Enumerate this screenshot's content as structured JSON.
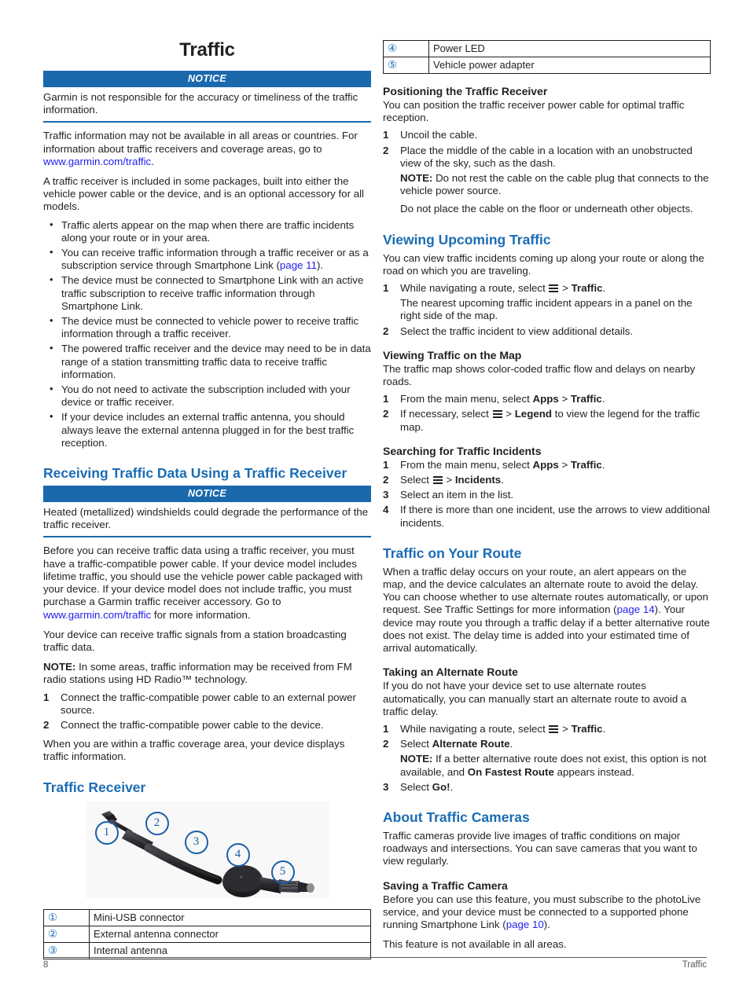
{
  "document": {
    "title": "Traffic",
    "footer_page": "8",
    "footer_section": "Traffic"
  },
  "colors": {
    "heading_blue": "#1a6cb4",
    "notice_bar_blue": "#1a69ad",
    "link_blue": "#2222ee",
    "callout_blue": "#1a5fa8",
    "text": "#231f20"
  },
  "left_column": {
    "notice1": {
      "label": "NOTICE",
      "text": "Garmin is not responsible for the accuracy or timeliness of the traffic information."
    },
    "para1_a": "Traffic information may not be available in all areas or countries. For information about traffic receivers and coverage areas, go to ",
    "para1_link": "www.garmin.com/traffic",
    "para1_b": ".",
    "para2": "A traffic receiver is included in some packages, built into either the vehicle power cable or the device, and is an optional accessory for all models.",
    "bullets": [
      {
        "text_a": "Traffic alerts appear on the map when there are traffic incidents along your route or in your area.",
        "link": "",
        "text_b": ""
      },
      {
        "text_a": "You can receive traffic information through a traffic receiver or as a subscription service through Smartphone Link (",
        "link": "page 11",
        "text_b": ")."
      },
      {
        "text_a": "The device must be connected to Smartphone Link with an active traffic subscription to receive traffic information through Smartphone Link.",
        "link": "",
        "text_b": ""
      },
      {
        "text_a": "The device must be connected to vehicle power to receive traffic information through a traffic receiver.",
        "link": "",
        "text_b": ""
      },
      {
        "text_a": "The powered traffic receiver and the device may need to be in data range of a station transmitting traffic data to receive traffic information.",
        "link": "",
        "text_b": ""
      },
      {
        "text_a": "You do not need to activate the subscription included with your device or traffic receiver.",
        "link": "",
        "text_b": ""
      },
      {
        "text_a": "If your device includes an external traffic antenna, you should always leave the external antenna plugged in for the best traffic reception.",
        "link": "",
        "text_b": ""
      }
    ],
    "heading_receiving": "Receiving Traffic Data Using a Traffic Receiver",
    "notice2": {
      "label": "NOTICE",
      "text": "Heated (metallized) windshields could degrade the performance of the traffic receiver."
    },
    "para3_a": "Before you can receive traffic data using a traffic receiver, you must have a traffic-compatible power cable. If your device model includes lifetime traffic, you should use the vehicle power cable packaged with your device. If your device model does not include traffic, you must purchase a Garmin traffic receiver accessory. Go to ",
    "para3_link": "www.garmin.com/traffic",
    "para3_b": " for more information.",
    "para4": "Your device can receive traffic signals from a station broadcasting traffic data.",
    "note1_label": "NOTE:",
    "note1_text": " In some areas, traffic information may be received from FM radio stations using HD Radio™ technology.",
    "steps_receiving": [
      {
        "num": "1",
        "text": "Connect the traffic-compatible power cable to an external power source."
      },
      {
        "num": "2",
        "text": "Connect the traffic-compatible power cable to the device."
      }
    ],
    "para5": "When you are within a traffic coverage area, your device displays traffic information.",
    "heading_receiver": "Traffic Receiver",
    "figure": {
      "name": "traffic-receiver-cable-diagram",
      "callouts": [
        "1",
        "2",
        "3",
        "4",
        "5"
      ]
    },
    "table_rows": [
      {
        "marker": "①",
        "label": "Mini-USB connector"
      },
      {
        "marker": "②",
        "label": "External antenna connector"
      },
      {
        "marker": "③",
        "label": "Internal antenna"
      }
    ]
  },
  "right_column": {
    "table_rows": [
      {
        "marker": "④",
        "label": "Power LED"
      },
      {
        "marker": "⑤",
        "label": "Vehicle power adapter"
      }
    ],
    "heading_positioning": "Positioning the Traffic Receiver",
    "para_positioning": "You can position the traffic receiver power cable for optimal traffic reception.",
    "steps_positioning": [
      {
        "num": "1",
        "text": "Uncoil the cable."
      },
      {
        "num": "2",
        "text": "Place the middle of the cable in a location with an unobstructed view of the sky, such as the dash."
      }
    ],
    "note_positioning_label": "NOTE:",
    "note_positioning_text": " Do not rest the cable on the cable plug that connects to the vehicle power source.",
    "note_positioning_extra": "Do not place the cable on the floor or underneath other objects.",
    "heading_viewing_upcoming": "Viewing Upcoming Traffic",
    "para_viewing_upcoming": "You can view traffic incidents coming up along your route or along the road on which you are traveling.",
    "step_vu_1_pre": "While navigating a route, select ",
    "step_vu_1_sep": " > ",
    "step_vu_1_bold": "Traffic",
    "step_vu_1_post": ".",
    "step_vu_1_sub": "The nearest upcoming traffic incident appears in a panel on the right side of the map.",
    "step_vu_2": "Select the traffic incident to view additional details.",
    "heading_viewing_map": "Viewing Traffic on the Map",
    "para_viewing_map": "The traffic map shows color-coded traffic flow and delays on nearby roads.",
    "step_vm_1_pre": "From the main menu, select ",
    "step_vm_1_bold1": "Apps",
    "step_vm_1_sep": " > ",
    "step_vm_1_bold2": "Traffic",
    "step_vm_1_post": ".",
    "step_vm_2_pre": "If necessary, select ",
    "step_vm_2_sep": " > ",
    "step_vm_2_bold": "Legend",
    "step_vm_2_post": " to view the legend for the traffic map.",
    "heading_searching": "Searching for Traffic Incidents",
    "step_s_1_pre": "From the main menu, select ",
    "step_s_1_bold1": "Apps",
    "step_s_1_sep": " > ",
    "step_s_1_bold2": "Traffic",
    "step_s_1_post": ".",
    "step_s_2_pre": "Select ",
    "step_s_2_sep": " > ",
    "step_s_2_bold": "Incidents",
    "step_s_2_post": ".",
    "step_s_3": "Select an item in the list.",
    "step_s_4": "If there is more than one incident, use the arrows to view additional incidents.",
    "heading_traffic_route": "Traffic on Your Route",
    "para_traffic_route_a": "When a traffic delay occurs on your route, an alert appears on the map, and the device calculates an alternate route to avoid the delay. You can choose whether to use alternate routes automatically, or upon request. See Traffic Settings for more information (",
    "para_traffic_route_link": "page 14",
    "para_traffic_route_b": "). Your device may route you through a traffic delay if a better alternative route does not exist. The delay time is added into your estimated time of arrival automatically.",
    "heading_alternate": "Taking an Alternate Route",
    "para_alternate": "If you do not have your device set to use alternate routes automatically, you can manually start an alternate route to avoid a traffic delay.",
    "step_a_1_pre": "While navigating a route, select ",
    "step_a_1_sep": " > ",
    "step_a_1_bold": "Traffic",
    "step_a_1_post": ".",
    "step_a_2_pre": "Select ",
    "step_a_2_bold": "Alternate Route",
    "step_a_2_post": ".",
    "step_a_2_note_label": "NOTE:",
    "step_a_2_note_a": " If a better alternative route does not exist, this option is not available, and ",
    "step_a_2_note_bold": "On Fastest Route",
    "step_a_2_note_b": " appears instead.",
    "step_a_3_pre": "Select ",
    "step_a_3_bold": "Go!",
    "step_a_3_post": ".",
    "heading_cameras": "About Traffic Cameras",
    "para_cameras": "Traffic cameras provide live images of traffic conditions on major roadways and intersections. You can save cameras that you want to view regularly.",
    "heading_saving_camera": "Saving a Traffic Camera",
    "para_saving_a": "Before you can use this feature, you must subscribe to the photoLive service, and your device must be connected to a supported phone running Smartphone Link (",
    "para_saving_link": "page 10",
    "para_saving_b": ").",
    "para_saving_extra": "This feature is not available in all areas."
  }
}
